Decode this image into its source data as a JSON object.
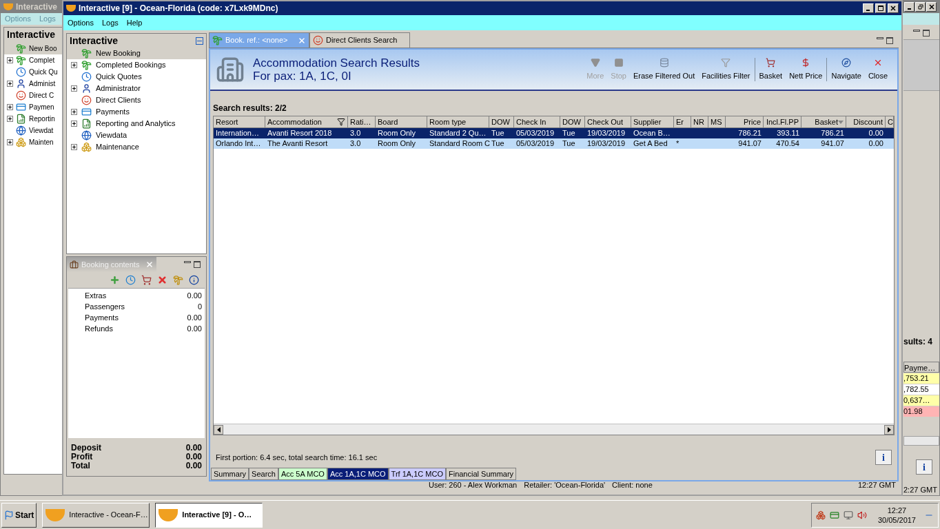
{
  "back_window": {
    "title": "Interactive",
    "menu": [
      "Options",
      "Logs"
    ],
    "panel_title": "Interactive",
    "tree": [
      {
        "label": "New Boo",
        "expandable": false,
        "selected": true
      },
      {
        "label": "Complet",
        "expandable": true,
        "selected": false
      },
      {
        "label": "Quick Qu",
        "expandable": false,
        "selected": false
      },
      {
        "label": "Administ",
        "expandable": true,
        "selected": false
      },
      {
        "label": "Direct C",
        "expandable": false,
        "selected": false
      },
      {
        "label": "Paymen",
        "expandable": true,
        "selected": false
      },
      {
        "label": "Reportin",
        "expandable": true,
        "selected": false
      },
      {
        "label": "Viewdat",
        "expandable": false,
        "selected": false
      },
      {
        "label": "Mainten",
        "expandable": true,
        "selected": false
      }
    ],
    "results_label": "sults: 4",
    "column_header": "Payme…",
    "rows": [
      {
        "value": ",753.21",
        "color": "#ffffa8"
      },
      {
        "value": ",782.55",
        "color": "#ffffff"
      },
      {
        "value": "0,637…",
        "color": "#ffffa8"
      },
      {
        "value": "01.98",
        "color": "#ffb4b4"
      }
    ],
    "info_button": "i",
    "time": "2:27 GMT"
  },
  "window": {
    "title": "Interactive [9] - Ocean-Florida (code: x7Lxk9MDnc)",
    "menu": [
      "Options",
      "Logs",
      "Help"
    ]
  },
  "navigator": {
    "title": "Interactive",
    "tree": [
      {
        "label": "New Booking",
        "expandable": false,
        "selected": true
      },
      {
        "label": "Completed Bookings",
        "expandable": true,
        "selected": false
      },
      {
        "label": "Quick Quotes",
        "expandable": false,
        "selected": false
      },
      {
        "label": "Administrator",
        "expandable": true,
        "selected": false
      },
      {
        "label": "Direct Clients",
        "expandable": false,
        "selected": false
      },
      {
        "label": "Payments",
        "expandable": true,
        "selected": false
      },
      {
        "label": "Reporting and Analytics",
        "expandable": true,
        "selected": false
      },
      {
        "label": "Viewdata",
        "expandable": false,
        "selected": false
      },
      {
        "label": "Maintenance",
        "expandable": true,
        "selected": false
      }
    ]
  },
  "booking_contents": {
    "title": "Booking contents",
    "items": [
      {
        "label": "Extras",
        "value": "0.00"
      },
      {
        "label": "Passengers",
        "value": "0"
      },
      {
        "label": "Payments",
        "value": "0.00"
      },
      {
        "label": "Refunds",
        "value": "0.00"
      }
    ],
    "totals": [
      {
        "label": "Deposit",
        "value": "0.00"
      },
      {
        "label": "Profit",
        "value": "0.00"
      },
      {
        "label": "Total",
        "value": "0.00"
      }
    ]
  },
  "editor_tabs": [
    {
      "label": "Book. ref.: <none>",
      "selected": true,
      "closable": true
    },
    {
      "label": "Direct Clients Search",
      "selected": false,
      "closable": false
    }
  ],
  "results": {
    "title": "Accommodation Search Results",
    "subtitle": "For pax: 1A, 1C, 0I",
    "toolbar": [
      [
        {
          "label": "More",
          "disabled": true
        },
        {
          "label": "Stop",
          "disabled": true
        },
        {
          "label": "Erase Filtered Out",
          "disabled": false
        },
        {
          "label": "Facilities Filter",
          "disabled": false
        }
      ],
      [
        {
          "label": "Basket",
          "disabled": false
        },
        {
          "label": "Nett Price",
          "disabled": false
        }
      ],
      [
        {
          "label": "Navigate",
          "disabled": false
        },
        {
          "label": "Close",
          "disabled": false
        }
      ]
    ],
    "count_label": "Search results: 2/2",
    "table": {
      "columns": [
        "Resort",
        "Accommodation",
        "Rati…",
        "Board",
        "Room type",
        "DOW",
        "Check In",
        "DOW",
        "Check Out",
        "Supplier",
        "Er",
        "NR",
        "MS",
        "Price",
        "Incl.Fl.PP",
        "Basket",
        "Discount",
        "C"
      ],
      "rows": [
        {
          "selected": true,
          "cells": [
            "Internation…",
            "Avanti Resort 2018",
            "3.0",
            "Room Only",
            "Standard 2 Qu…",
            "Tue",
            "05/03/2019",
            "Tue",
            "19/03/2019",
            "Ocean B…",
            "",
            "",
            "",
            "786.21",
            "393.11",
            "786.21",
            "0.00",
            ""
          ]
        },
        {
          "selected": false,
          "cells": [
            "Orlando Int…",
            "The Avanti Resort",
            "3.0",
            "Room Only",
            "Standard Room C",
            "Tue",
            "05/03/2019",
            "Tue",
            "19/03/2019",
            "Get A Bed",
            "*",
            "",
            "",
            "941.07",
            "470.54",
            "941.07",
            "0.00",
            ""
          ]
        }
      ]
    },
    "timing": "First portion: 6.4 sec, total search time: 16.1 sec",
    "info_button": "i",
    "bottom_tabs": [
      {
        "label": "Summary",
        "selected": false,
        "color": "#d4d0c8"
      },
      {
        "label": "Search",
        "selected": false,
        "color": "#d4d0c8"
      },
      {
        "label": "Acc 5A MCO",
        "selected": false,
        "color": "#ccffcc"
      },
      {
        "label": "Acc 1A,1C MCO",
        "selected": true,
        "color": "#0a1e78"
      },
      {
        "label": "Trf 1A,1C MCO",
        "selected": false,
        "color": "#ccccff"
      },
      {
        "label": "Financial Summary",
        "selected": false,
        "color": "#d4d0c8"
      }
    ]
  },
  "status_bar": {
    "items": [
      "User: 260 - Alex Workman",
      "Retailer: 'Ocean-Florida'",
      "Client: none"
    ],
    "time": "12:27 GMT"
  },
  "taskbar": {
    "start": "Start",
    "buttons": [
      {
        "label": "Interactive - Ocean-F…",
        "selected": false
      },
      {
        "label": "Interactive [9] - O…",
        "selected": true
      }
    ],
    "clock_time": "12:27",
    "clock_date": "30/05/2017"
  }
}
